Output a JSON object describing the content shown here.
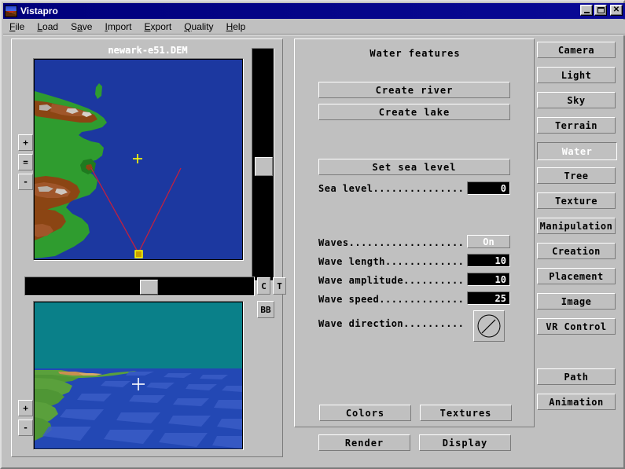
{
  "window": {
    "title": "Vistapro",
    "icon": "vistapro-mountain-icon",
    "minimize_label": "_",
    "maximize_label": "□",
    "close_label": "✕"
  },
  "menu": {
    "items": [
      {
        "label": "File"
      },
      {
        "label": "Load"
      },
      {
        "label": "Save"
      },
      {
        "label": "Import"
      },
      {
        "label": "Export"
      },
      {
        "label": "Quality"
      },
      {
        "label": "Help"
      }
    ]
  },
  "map_panel": {
    "title": "newark-e51.DEM",
    "zoom_in_label": "+",
    "zoom_eq_label": "=",
    "zoom_out_label": "-",
    "c_button_label": "C",
    "t_button_label": "T",
    "bb_button_label": "BB"
  },
  "preview_panel": {
    "zoom_in_label": "+",
    "zoom_out_label": "-"
  },
  "water_panel": {
    "title": "Water features",
    "create_river_label": "Create river",
    "create_lake_label": "Create lake",
    "set_sea_level_label": "Set sea level",
    "sea_level_label": "Sea level...............",
    "sea_level_value": "0",
    "waves_label": "Waves...................",
    "waves_value": "On",
    "wave_length_label": "Wave length.............",
    "wave_length_value": "10",
    "wave_amplitude_label": "Wave amplitude..........",
    "wave_amplitude_value": "10",
    "wave_speed_label": "Wave speed..............",
    "wave_speed_value": "25",
    "wave_direction_label": "Wave direction..........",
    "wave_direction_dial": "wave-direction-dial",
    "colors_label": "Colors",
    "textures_label": "Textures"
  },
  "bottom_actions": {
    "render_label": "Render",
    "display_label": "Display"
  },
  "sidebar": {
    "buttons": [
      {
        "label": "Camera",
        "active": false
      },
      {
        "label": "Light",
        "active": false
      },
      {
        "label": "Sky",
        "active": false
      },
      {
        "label": "Terrain",
        "active": false
      },
      {
        "label": "Water",
        "active": true
      },
      {
        "label": "Tree",
        "active": false
      },
      {
        "label": "Texture",
        "active": false
      },
      {
        "label": "Manipulation",
        "active": false
      },
      {
        "label": "Creation",
        "active": false
      },
      {
        "label": "Placement",
        "active": false
      },
      {
        "label": "Image",
        "active": false
      },
      {
        "label": "VR Control",
        "active": false
      },
      {
        "label": "Path",
        "active": false
      },
      {
        "label": "Animation",
        "active": false
      }
    ]
  },
  "colors": {
    "face": "#c0c0c0",
    "titlebar": "#00007b",
    "map_water": "#1c38a0",
    "map_land_green": "#2f9c2f",
    "map_land_brown": "#8b4513",
    "preview_sky": "#0a8089",
    "preview_water": "#2348b4",
    "view_cone": "#c02040",
    "marker": "#ffff00"
  }
}
